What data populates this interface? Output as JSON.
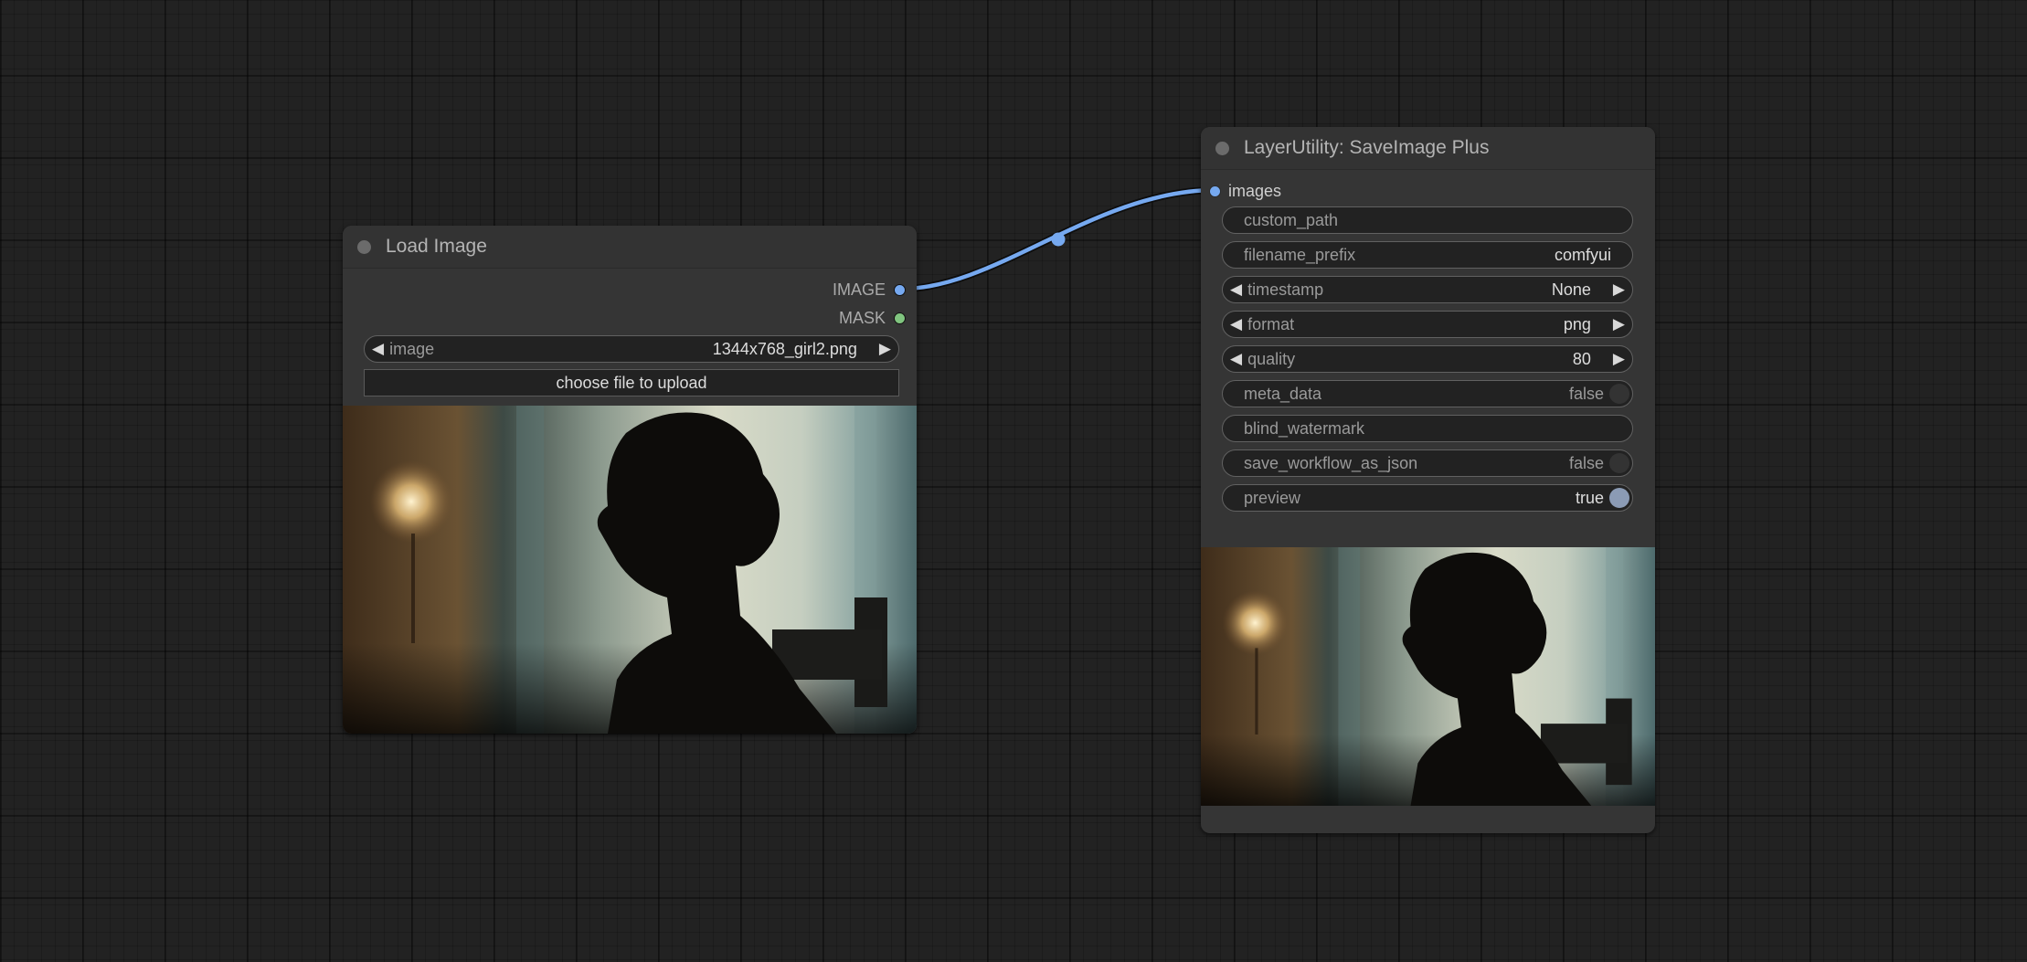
{
  "canvas": {
    "link_color": "#76a9f0"
  },
  "load_image_node": {
    "title": "Load Image",
    "outputs": [
      {
        "label": "IMAGE",
        "color": "#76a9f0"
      },
      {
        "label": "MASK",
        "color": "#80c47f"
      }
    ],
    "image_widget": {
      "name": "image",
      "value": "1344x768_girl2.png"
    },
    "upload_button": "choose file to upload",
    "preview_icon": "image-preview-woman-silhouette"
  },
  "save_image_node": {
    "title": "LayerUtility: SaveImage Plus",
    "input": {
      "label": "images",
      "color": "#76a9f0"
    },
    "widgets": [
      {
        "name": "custom_path",
        "value": ""
      },
      {
        "name": "filename_prefix",
        "value": "comfyui"
      },
      {
        "name": "timestamp",
        "value": "None"
      },
      {
        "name": "format",
        "value": "png"
      },
      {
        "name": "quality",
        "value": "80"
      },
      {
        "name": "meta_data",
        "value": "false"
      },
      {
        "name": "blind_watermark",
        "value": ""
      },
      {
        "name": "save_workflow_as_json",
        "value": "false"
      },
      {
        "name": "preview",
        "value": "true"
      }
    ],
    "preview_icon": "image-preview-woman-silhouette"
  },
  "icons": {
    "left_arrow": "◀",
    "right_arrow": "▶"
  }
}
